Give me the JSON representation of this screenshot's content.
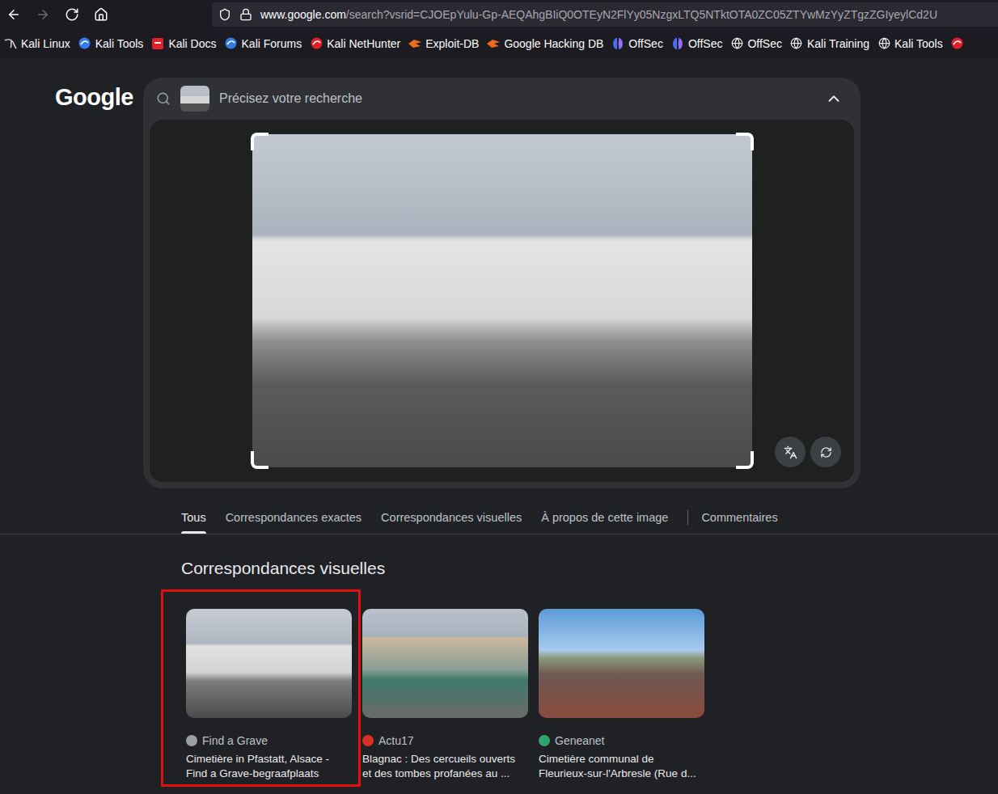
{
  "toolbar": {
    "nav": [
      {
        "kind": "back",
        "disabled": false
      },
      {
        "kind": "forward",
        "disabled": true
      },
      {
        "kind": "reload",
        "disabled": false
      },
      {
        "kind": "home",
        "disabled": false
      }
    ]
  },
  "address_bar": {
    "host": "www.google.com",
    "path": "/search?vsrid=CJOEpYulu-Gp-AEQAhgBIiQ0OTEyN2FlYy05NzgxLTQ5NTktOTA0ZC05ZTYwMzYyZTgzZGIyeylCd2U"
  },
  "bookmarks": [
    {
      "label": "Kali Linux",
      "kind": "dragon",
      "color": "#d0d0d0"
    },
    {
      "label": "Kali Tools",
      "kind": "ball",
      "color": "#367bf0"
    },
    {
      "label": "Kali Docs",
      "kind": "badge",
      "color": "#e0202a"
    },
    {
      "label": "Kali Forums",
      "kind": "ball",
      "color": "#2f7de1"
    },
    {
      "label": "Kali NetHunter",
      "kind": "ball",
      "color": "#e0202a"
    },
    {
      "label": "Exploit-DB",
      "kind": "flame",
      "color": "#ee6a1f"
    },
    {
      "label": "Google Hacking DB",
      "kind": "flame",
      "color": "#ee6a1f"
    },
    {
      "label": "OffSec",
      "kind": "offsec",
      "color": "#4a6cf7"
    },
    {
      "label": "OffSec",
      "kind": "offsec",
      "color": "#4a6cf7"
    },
    {
      "label": "OffSec",
      "kind": "globe",
      "color": "#e8e8e8"
    },
    {
      "label": "Kali Training",
      "kind": "globe",
      "color": "#e8e8e8"
    },
    {
      "label": "Kali Tools",
      "kind": "globe",
      "color": "#e8e8e8"
    },
    {
      "label": "",
      "kind": "ball",
      "color": "#e0202a"
    }
  ],
  "logo": "Google",
  "search": {
    "placeholder": "Précisez votre recherche",
    "expanded": true
  },
  "tabs": [
    {
      "label": "Tous",
      "selected": true,
      "divider_before": false
    },
    {
      "label": "Correspondances exactes",
      "selected": false,
      "divider_before": false
    },
    {
      "label": "Correspondances visuelles",
      "selected": false,
      "divider_before": false
    },
    {
      "label": "À propos de cette image",
      "selected": false,
      "divider_before": false
    },
    {
      "label": "Commentaires",
      "selected": false,
      "divider_before": true
    }
  ],
  "section_title": "Correspondances visuelles",
  "results": [
    {
      "source": "Find a Grave",
      "title_lines": [
        "Cimetière in Pfastatt, Alsace -",
        "Find a Grave-begraafplaats"
      ],
      "highlighted": true,
      "color": "#9aa0a6"
    },
    {
      "source": "Actu17",
      "title_lines": [
        "Blagnac : Des cercueils ouverts",
        "et des tombes profanées au ..."
      ],
      "highlighted": false,
      "color": "#d93025"
    },
    {
      "source": "Geneanet",
      "title_lines": [
        "Cimetière communal de",
        "Fleurieux-sur-l'Arbresle (Rue d..."
      ],
      "highlighted": false,
      "color": "#2fa36b"
    }
  ]
}
